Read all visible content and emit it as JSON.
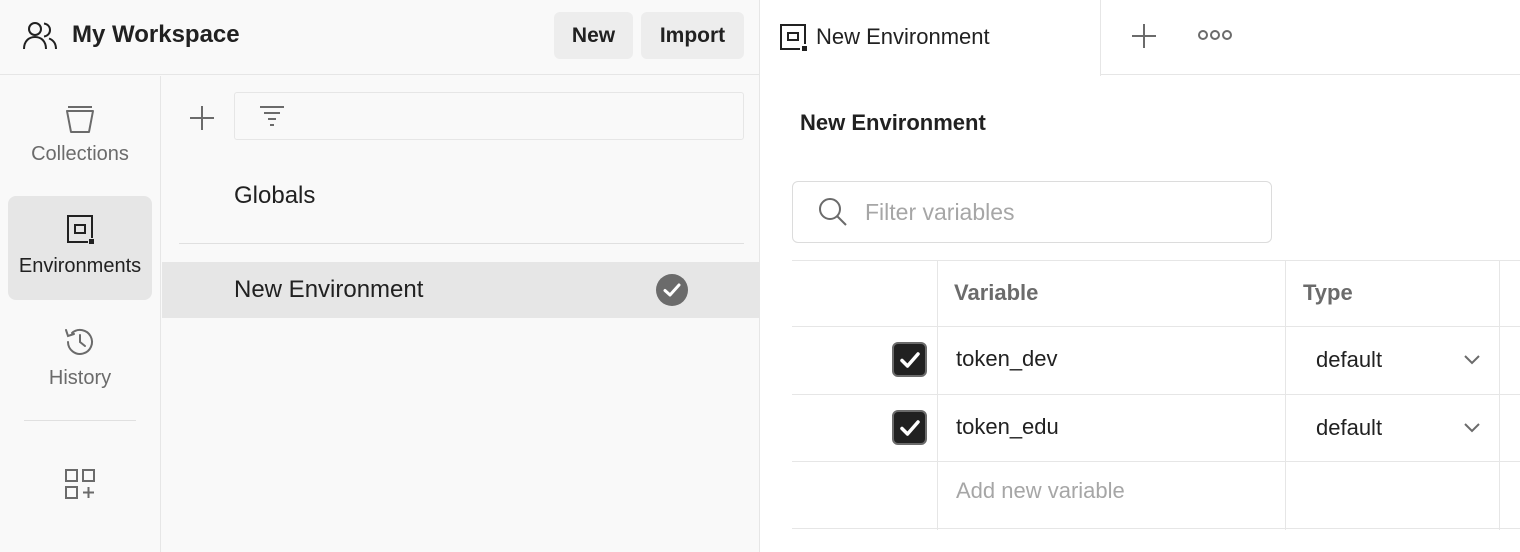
{
  "workspace": {
    "title": "My Workspace",
    "new_button": "New",
    "import_button": "Import"
  },
  "sidebar": {
    "items": [
      {
        "label": "Collections",
        "icon": "collections-icon",
        "active": false
      },
      {
        "label": "Environments",
        "icon": "environments-icon",
        "active": true
      },
      {
        "label": "History",
        "icon": "history-icon",
        "active": false
      }
    ],
    "apps_icon": "add-apps-icon"
  },
  "env_list": {
    "globals": "Globals",
    "items": [
      {
        "label": "New Environment",
        "active": true,
        "icon": "check-circle-icon"
      }
    ]
  },
  "tabs": {
    "items": [
      {
        "label": "New Environment",
        "icon": "environment-icon"
      }
    ],
    "add_icon": "plus-icon",
    "more_icon": "more-horizontal-icon"
  },
  "editor": {
    "title": "New Environment",
    "filter_placeholder": "Filter variables",
    "columns": [
      "Variable",
      "Type"
    ],
    "rows": [
      {
        "enabled": true,
        "variable": "token_dev",
        "type": "default"
      },
      {
        "enabled": true,
        "variable": "token_edu",
        "type": "default"
      }
    ],
    "add_placeholder": "Add new variable"
  },
  "colors": {
    "sidebar_bg": "#f9f9f9",
    "active_bg": "#e6e6e6",
    "text": "#212121",
    "muted": "#6b6b6b",
    "checkbox": "#212121"
  }
}
